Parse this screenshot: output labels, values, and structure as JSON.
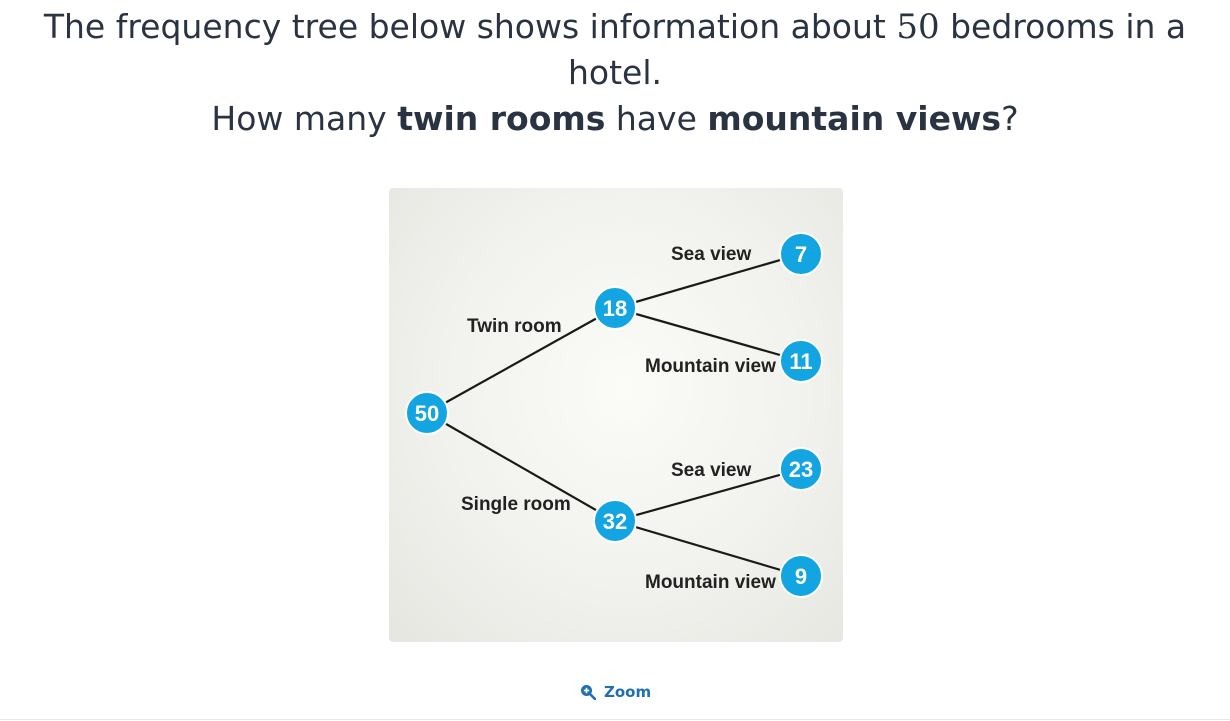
{
  "question": {
    "line1_prefix": "The frequency tree below shows information about ",
    "line1_number": "50",
    "line1_suffix": " bedrooms in a hotel.",
    "line2_prefix": "How many ",
    "line2_bold1": "twin rooms",
    "line2_mid": " have ",
    "line2_bold2": "mountain views",
    "line2_suffix": "?"
  },
  "tree": {
    "root": "50",
    "branch_twin_label": "Twin room",
    "branch_single_label": "Single room",
    "twin_total": "18",
    "single_total": "32",
    "twin_sea_label": "Sea view",
    "twin_sea": "7",
    "twin_mountain_label": "Mountain view",
    "twin_mountain": "11",
    "single_sea_label": "Sea view",
    "single_sea": "23",
    "single_mountain_label": "Mountain view",
    "single_mountain": "9",
    "node_color": "#12a5e2"
  },
  "zoom": {
    "label": "Zoom",
    "icon": "zoom-in-icon"
  }
}
